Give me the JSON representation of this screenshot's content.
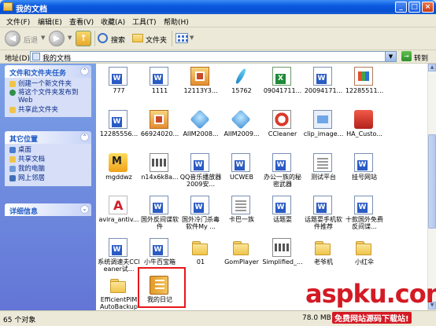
{
  "window": {
    "title": "我的文档",
    "controls": [
      "_",
      "□",
      "×"
    ]
  },
  "menu": [
    "文件(F)",
    "编辑(E)",
    "查看(V)",
    "收藏(A)",
    "工具(T)",
    "帮助(H)"
  ],
  "toolbar": {
    "back_label": "后退",
    "search_label": "搜索",
    "folders_label": "文件夹"
  },
  "address": {
    "label": "地址(D)",
    "value": "我的文档",
    "go_label": "转到"
  },
  "sidebar": {
    "tasks": {
      "title": "文件和文件夹任务",
      "items": [
        "创建一个新文件夹",
        "将这个文件夹发布到 Web",
        "共享此文件夹"
      ]
    },
    "places": {
      "title": "其它位置",
      "items": [
        "桌面",
        "共享文档",
        "我的电脑",
        "网上邻居"
      ]
    },
    "details": {
      "title": "详细信息"
    }
  },
  "files": [
    {
      "label": "777",
      "icon": "word"
    },
    {
      "label": "1111",
      "icon": "word"
    },
    {
      "label": "12113Y3...",
      "icon": "img"
    },
    {
      "label": "15762",
      "icon": "feather"
    },
    {
      "label": "09041711...",
      "icon": "excel"
    },
    {
      "label": "20094171...",
      "icon": "word"
    },
    {
      "label": "12285511...",
      "icon": "ppt"
    },
    {
      "label": "12285556...",
      "icon": "word"
    },
    {
      "label": "66924020...",
      "icon": "img"
    },
    {
      "label": "AIIM2008...",
      "icon": "cube"
    },
    {
      "label": "AIIM2009...",
      "icon": "cube"
    },
    {
      "label": "CCleaner",
      "icon": "cc"
    },
    {
      "label": "clip_image...",
      "icon": "clip"
    },
    {
      "label": "HA_Custo...",
      "icon": "red"
    },
    {
      "label": "mgddwz",
      "icon": "mgd"
    },
    {
      "label": "n14x6k8a...",
      "icon": "film"
    },
    {
      "label": "QQ音乐播放器2009安...",
      "icon": "word"
    },
    {
      "label": "UCWEB",
      "icon": "word"
    },
    {
      "label": "办公一族的秘密武器",
      "icon": "word"
    },
    {
      "label": "测试平台",
      "icon": "doc"
    },
    {
      "label": "挂号网站",
      "icon": "word"
    },
    {
      "label": "avira_antiv...",
      "icon": "avira"
    },
    {
      "label": "国外反间谍软件",
      "icon": "word"
    },
    {
      "label": "国外冷门杀毒软件My ...",
      "icon": "word"
    },
    {
      "label": "卡巴一族",
      "icon": "doc"
    },
    {
      "label": "话题耍",
      "icon": "word"
    },
    {
      "label": "话题耍手机软件推荐",
      "icon": "word"
    },
    {
      "label": "十款国外免费反间谍...",
      "icon": "word"
    },
    {
      "label": "系统调速夫CCleaner试...",
      "icon": "word"
    },
    {
      "label": "小牛百宝箱",
      "icon": "word"
    },
    {
      "label": "01",
      "icon": "folder"
    },
    {
      "label": "GomPlayer",
      "icon": "folder"
    },
    {
      "label": "Simplified_...",
      "icon": "film"
    },
    {
      "label": "老爷机",
      "icon": "folder"
    },
    {
      "label": "小红伞",
      "icon": "folder"
    },
    {
      "label": "EfficientPIM AutoBackup",
      "icon": "folder"
    },
    {
      "label": "我的日记",
      "icon": "note"
    }
  ],
  "status": {
    "count": "65 个对象",
    "size": "78.0 MB"
  },
  "watermark": {
    "main": "aspku.com",
    "sub": "免费网站源码下载站!"
  }
}
